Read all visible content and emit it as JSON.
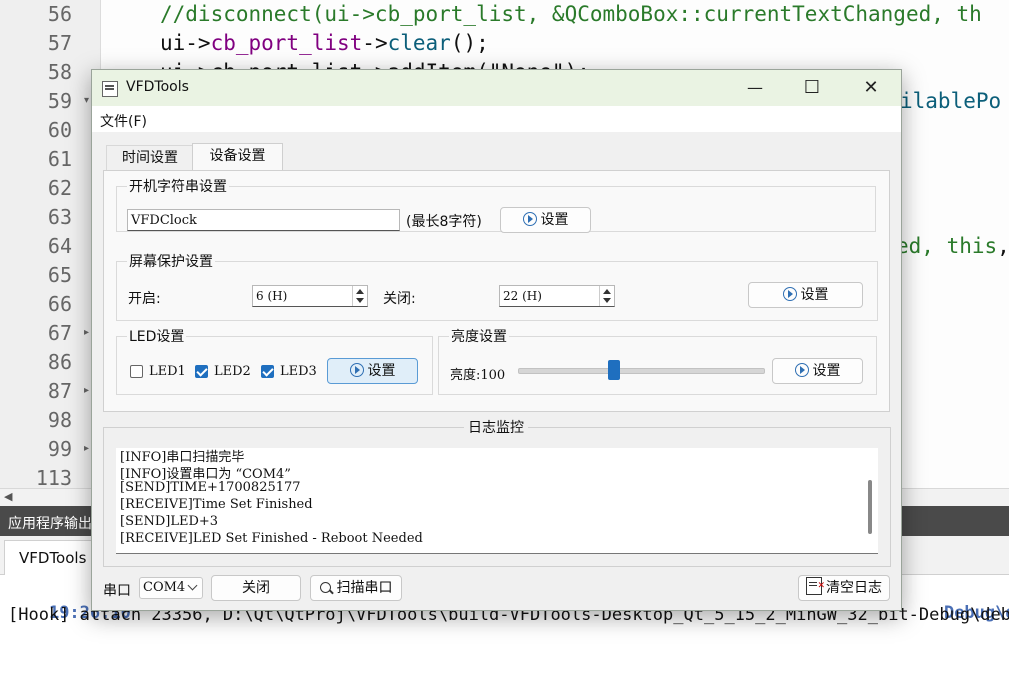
{
  "editor": {
    "lines": [
      {
        "num": "56",
        "fold": ""
      },
      {
        "num": "57",
        "fold": ""
      },
      {
        "num": "58",
        "fold": ""
      },
      {
        "num": "59",
        "fold": "▾"
      },
      {
        "num": "60",
        "fold": ""
      },
      {
        "num": "61",
        "fold": ""
      },
      {
        "num": "62",
        "fold": ""
      },
      {
        "num": "63",
        "fold": ""
      },
      {
        "num": "64",
        "fold": ""
      },
      {
        "num": "65",
        "fold": ""
      },
      {
        "num": "66",
        "fold": ""
      },
      {
        "num": "67",
        "fold": "▸"
      },
      {
        "num": "86",
        "fold": ""
      },
      {
        "num": "87",
        "fold": "▸"
      },
      {
        "num": "98",
        "fold": ""
      },
      {
        "num": "99",
        "fold": "▸"
      },
      {
        "num": "113",
        "fold": ""
      }
    ],
    "code_line_56": "//disconnect(ui->cb_port_list, &QComboBox::currentTextChanged, th",
    "code_line_57_a": "ui->",
    "code_line_57_b": "cb_port_list",
    "code_line_57_c": "->",
    "code_line_57_d": "clear",
    "code_line_57_e": "();",
    "code_line_58": "ui->cb_port_list->addItem(\"None\");",
    "code_line_59_tail": "ilablePo",
    "code_line_64_tail_a": "ed, ",
    "code_line_64_tail_b": "this",
    "code_line_64_tail_c": ","
  },
  "output_pane": {
    "title": "应用程序输出",
    "tab": "VFDTools",
    "line1_time": "19:26:10",
    "line1_tail": "Debug\\debu",
    "line2": "[Hook] attach 23356, D:\\Qt\\QtProj\\VFDTools\\build-VFDTools-Desktop_Qt_5_15_2_MinGW_32_bit-Debug\\deb"
  },
  "window": {
    "title": "VFDTools",
    "minimize": "—",
    "maximize": "☐",
    "close": "✕",
    "menu_file": "文件(F)"
  },
  "tabs": {
    "time": "时间设置",
    "device": "设备设置",
    "active": "device"
  },
  "boot_string": {
    "group_title": "开机字符串设置",
    "value": "VFDClock",
    "hint": "(最长8字符)",
    "button": "设置"
  },
  "screensaver": {
    "group_title": "屏幕保护设置",
    "on_label": "开启:",
    "on_value": "6 (H)",
    "off_label": "关闭:",
    "off_value": "22 (H)",
    "button": "设置"
  },
  "led": {
    "group_title": "LED设置",
    "items": [
      {
        "label": "LED1",
        "checked": false
      },
      {
        "label": "LED2",
        "checked": true
      },
      {
        "label": "LED3",
        "checked": true
      }
    ],
    "button": "设置"
  },
  "brightness": {
    "group_title": "亮度设置",
    "label": "亮度:100",
    "slider_fraction": 0.39,
    "button": "设置"
  },
  "log": {
    "title": "日志监控",
    "lines": [
      "[INFO]串口扫描完毕",
      "[INFO]设置串口为 “COM4”",
      "[SEND]TIME+1700825177",
      "[RECEIVE]Time Set Finished",
      "[SEND]LED+3",
      "[RECEIVE]LED Set Finished - Reboot Needed"
    ]
  },
  "bottom": {
    "port_label": "串口",
    "port_value": "COM4",
    "close_button": "关闭",
    "scan_button": "扫描串口",
    "clear_button": "清空日志"
  },
  "colors": {
    "titlebar": "#eaf3e3",
    "accent": "#1f6fbf"
  }
}
